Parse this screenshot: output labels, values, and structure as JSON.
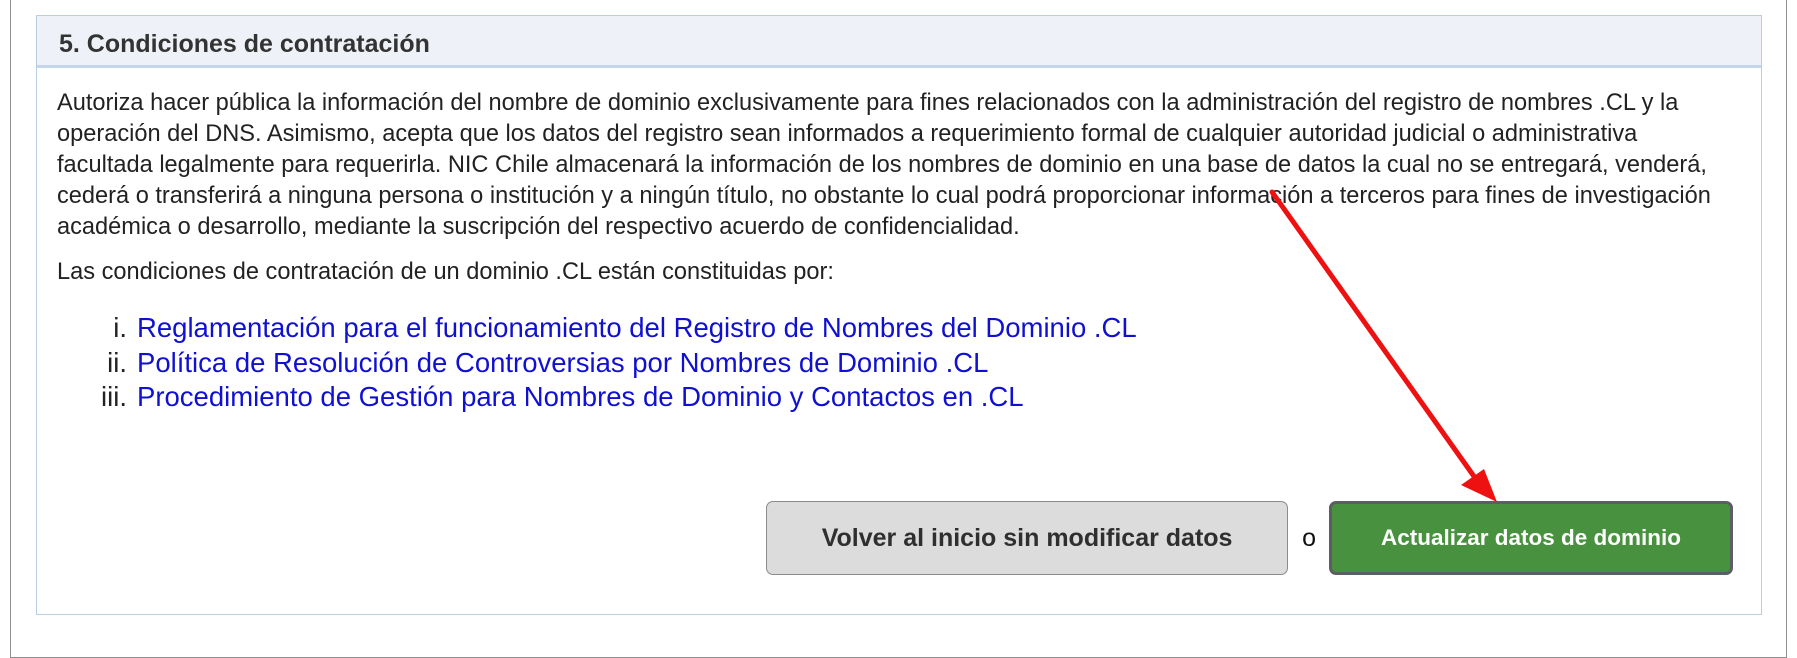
{
  "section": {
    "title": "5. Condiciones de contratación"
  },
  "body": {
    "paragraph_1": "Autoriza hacer pública la información del nombre de dominio exclusivamente para fines relacionados con la administración del registro de nombres .CL y la operación del DNS. Asimismo, acepta que los datos del registro sean informados a requerimiento formal de cualquier autoridad judicial o administrativa facultada legalmente para requerirla. NIC Chile almacenará la información de los nombres de dominio en una base de datos la cual no se entregará, venderá, cederá o transferirá a ninguna persona o institución y a ningún título, no obstante lo cual podrá proporcionar información a terceros para fines de investigación académica o desarrollo, mediante la suscripción del respectivo acuerdo de confidencialidad.",
    "paragraph_2": "Las condiciones de contratación de un dominio .CL están constituidas por:"
  },
  "documents": [
    {
      "num": "i.",
      "label": "Reglamentación para el funcionamiento del Registro de Nombres del Dominio .CL"
    },
    {
      "num": "ii.",
      "label": "Política de Resolución de Controversias por Nombres de Dominio .CL"
    },
    {
      "num": "iii.",
      "label": "Procedimiento de Gestión para Nombres de Dominio y Contactos en .CL"
    }
  ],
  "actions": {
    "back_label": "Volver al inicio sin modificar datos",
    "separator": "o",
    "update_label": "Actualizar datos de dominio"
  },
  "colors": {
    "link": "#1010d0",
    "primary_button": "#48913e",
    "secondary_button": "#dcdcdc",
    "annotation_arrow": "#ee1111"
  },
  "icons": {
    "annotation": "red-arrow-icon"
  }
}
